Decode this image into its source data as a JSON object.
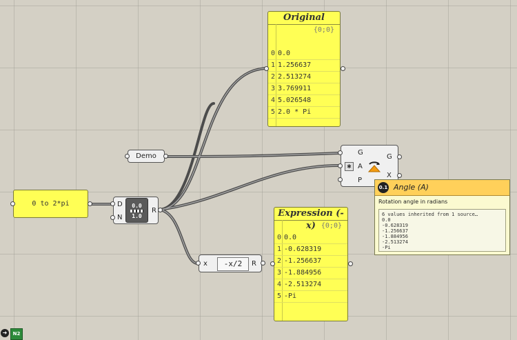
{
  "panel_original": {
    "title": "Original",
    "path": "{0;0}",
    "items": [
      {
        "i": "0",
        "v": "0.0"
      },
      {
        "i": "1",
        "v": "1.256637"
      },
      {
        "i": "2",
        "v": "2.513274"
      },
      {
        "i": "3",
        "v": "3.769911"
      },
      {
        "i": "4",
        "v": "5.026548"
      },
      {
        "i": "5",
        "v": "2.0 * Pi"
      }
    ]
  },
  "panel_expression": {
    "title": "Expression (-x)",
    "path": "{0;0}",
    "items": [
      {
        "i": "0",
        "v": "0.0"
      },
      {
        "i": "1",
        "v": "-0.628319"
      },
      {
        "i": "2",
        "v": "-1.256637"
      },
      {
        "i": "3",
        "v": "-1.884956"
      },
      {
        "i": "4",
        "v": "-2.513274"
      },
      {
        "i": "5",
        "v": "-Pi"
      }
    ]
  },
  "domain_panel": {
    "text": "0 to 2*pi"
  },
  "demo_param": {
    "label": "Demo"
  },
  "range_component": {
    "input_d": "D",
    "input_n": "N",
    "output_r": "R",
    "icon_top": "0.0",
    "icon_bottom": "1.0"
  },
  "expression_component": {
    "input_x": "x",
    "expression": "-x/2",
    "output_r": "R"
  },
  "rotate_component": {
    "input_g": "G",
    "input_a": "A",
    "input_p": "P",
    "output_g": "G",
    "output_x": "X"
  },
  "tooltip": {
    "title": "Angle (A)",
    "badge": "0.1",
    "description": "Rotation angle in radians",
    "lines": [
      "6 values inherited from 1 source…",
      "0.0",
      "-0.628319",
      "-1.256637",
      "-1.884956",
      "-2.513274",
      "-Pi"
    ]
  },
  "statusbar": {
    "icon": "N2"
  },
  "colors": {
    "canvas": "#d4d0c5",
    "panel": "#ffff55",
    "tooltip_header": "#ffd05a",
    "wire": "#555555"
  }
}
